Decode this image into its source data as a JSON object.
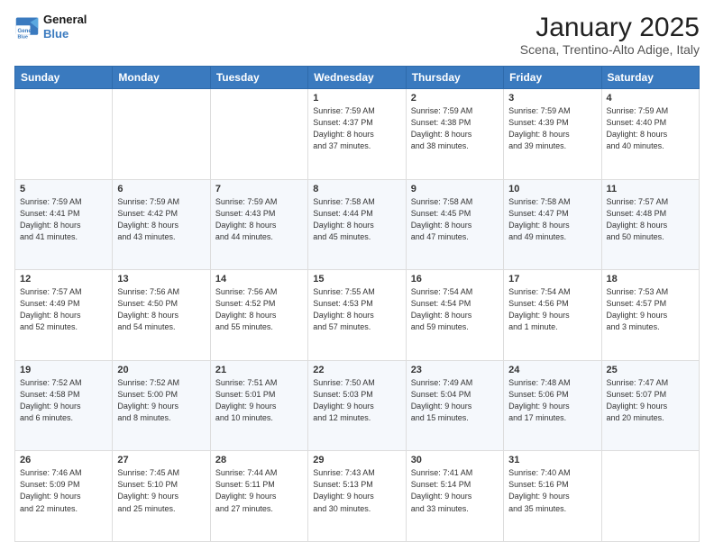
{
  "header": {
    "logo_line1": "General",
    "logo_line2": "Blue",
    "month": "January 2025",
    "location": "Scena, Trentino-Alto Adige, Italy"
  },
  "weekdays": [
    "Sunday",
    "Monday",
    "Tuesday",
    "Wednesday",
    "Thursday",
    "Friday",
    "Saturday"
  ],
  "weeks": [
    [
      {
        "day": "",
        "info": ""
      },
      {
        "day": "",
        "info": ""
      },
      {
        "day": "",
        "info": ""
      },
      {
        "day": "1",
        "info": "Sunrise: 7:59 AM\nSunset: 4:37 PM\nDaylight: 8 hours\nand 37 minutes."
      },
      {
        "day": "2",
        "info": "Sunrise: 7:59 AM\nSunset: 4:38 PM\nDaylight: 8 hours\nand 38 minutes."
      },
      {
        "day": "3",
        "info": "Sunrise: 7:59 AM\nSunset: 4:39 PM\nDaylight: 8 hours\nand 39 minutes."
      },
      {
        "day": "4",
        "info": "Sunrise: 7:59 AM\nSunset: 4:40 PM\nDaylight: 8 hours\nand 40 minutes."
      }
    ],
    [
      {
        "day": "5",
        "info": "Sunrise: 7:59 AM\nSunset: 4:41 PM\nDaylight: 8 hours\nand 41 minutes."
      },
      {
        "day": "6",
        "info": "Sunrise: 7:59 AM\nSunset: 4:42 PM\nDaylight: 8 hours\nand 43 minutes."
      },
      {
        "day": "7",
        "info": "Sunrise: 7:59 AM\nSunset: 4:43 PM\nDaylight: 8 hours\nand 44 minutes."
      },
      {
        "day": "8",
        "info": "Sunrise: 7:58 AM\nSunset: 4:44 PM\nDaylight: 8 hours\nand 45 minutes."
      },
      {
        "day": "9",
        "info": "Sunrise: 7:58 AM\nSunset: 4:45 PM\nDaylight: 8 hours\nand 47 minutes."
      },
      {
        "day": "10",
        "info": "Sunrise: 7:58 AM\nSunset: 4:47 PM\nDaylight: 8 hours\nand 49 minutes."
      },
      {
        "day": "11",
        "info": "Sunrise: 7:57 AM\nSunset: 4:48 PM\nDaylight: 8 hours\nand 50 minutes."
      }
    ],
    [
      {
        "day": "12",
        "info": "Sunrise: 7:57 AM\nSunset: 4:49 PM\nDaylight: 8 hours\nand 52 minutes."
      },
      {
        "day": "13",
        "info": "Sunrise: 7:56 AM\nSunset: 4:50 PM\nDaylight: 8 hours\nand 54 minutes."
      },
      {
        "day": "14",
        "info": "Sunrise: 7:56 AM\nSunset: 4:52 PM\nDaylight: 8 hours\nand 55 minutes."
      },
      {
        "day": "15",
        "info": "Sunrise: 7:55 AM\nSunset: 4:53 PM\nDaylight: 8 hours\nand 57 minutes."
      },
      {
        "day": "16",
        "info": "Sunrise: 7:54 AM\nSunset: 4:54 PM\nDaylight: 8 hours\nand 59 minutes."
      },
      {
        "day": "17",
        "info": "Sunrise: 7:54 AM\nSunset: 4:56 PM\nDaylight: 9 hours\nand 1 minute."
      },
      {
        "day": "18",
        "info": "Sunrise: 7:53 AM\nSunset: 4:57 PM\nDaylight: 9 hours\nand 3 minutes."
      }
    ],
    [
      {
        "day": "19",
        "info": "Sunrise: 7:52 AM\nSunset: 4:58 PM\nDaylight: 9 hours\nand 6 minutes."
      },
      {
        "day": "20",
        "info": "Sunrise: 7:52 AM\nSunset: 5:00 PM\nDaylight: 9 hours\nand 8 minutes."
      },
      {
        "day": "21",
        "info": "Sunrise: 7:51 AM\nSunset: 5:01 PM\nDaylight: 9 hours\nand 10 minutes."
      },
      {
        "day": "22",
        "info": "Sunrise: 7:50 AM\nSunset: 5:03 PM\nDaylight: 9 hours\nand 12 minutes."
      },
      {
        "day": "23",
        "info": "Sunrise: 7:49 AM\nSunset: 5:04 PM\nDaylight: 9 hours\nand 15 minutes."
      },
      {
        "day": "24",
        "info": "Sunrise: 7:48 AM\nSunset: 5:06 PM\nDaylight: 9 hours\nand 17 minutes."
      },
      {
        "day": "25",
        "info": "Sunrise: 7:47 AM\nSunset: 5:07 PM\nDaylight: 9 hours\nand 20 minutes."
      }
    ],
    [
      {
        "day": "26",
        "info": "Sunrise: 7:46 AM\nSunset: 5:09 PM\nDaylight: 9 hours\nand 22 minutes."
      },
      {
        "day": "27",
        "info": "Sunrise: 7:45 AM\nSunset: 5:10 PM\nDaylight: 9 hours\nand 25 minutes."
      },
      {
        "day": "28",
        "info": "Sunrise: 7:44 AM\nSunset: 5:11 PM\nDaylight: 9 hours\nand 27 minutes."
      },
      {
        "day": "29",
        "info": "Sunrise: 7:43 AM\nSunset: 5:13 PM\nDaylight: 9 hours\nand 30 minutes."
      },
      {
        "day": "30",
        "info": "Sunrise: 7:41 AM\nSunset: 5:14 PM\nDaylight: 9 hours\nand 33 minutes."
      },
      {
        "day": "31",
        "info": "Sunrise: 7:40 AM\nSunset: 5:16 PM\nDaylight: 9 hours\nand 35 minutes."
      },
      {
        "day": "",
        "info": ""
      }
    ]
  ]
}
